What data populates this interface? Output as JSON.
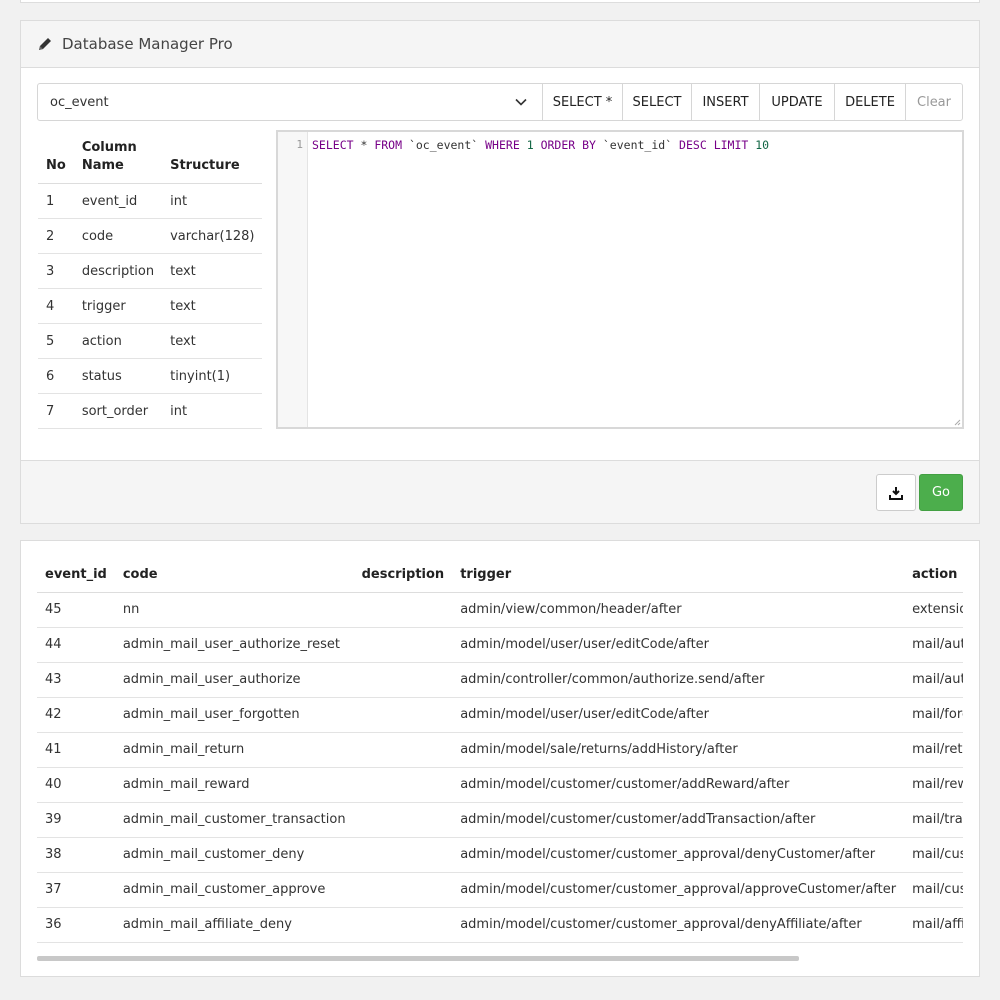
{
  "panel": {
    "title": "Database Manager Pro",
    "icon": "pencil-icon"
  },
  "toolbar": {
    "table_value": "oc_event",
    "buttons": [
      "SELECT *",
      "SELECT",
      "INSERT",
      "UPDATE",
      "DELETE",
      "Clear"
    ]
  },
  "columns_table": {
    "headers": {
      "no": "No",
      "name": "Column Name",
      "structure": "Structure"
    },
    "rows": [
      {
        "no": "1",
        "name": "event_id",
        "structure": "int"
      },
      {
        "no": "2",
        "name": "code",
        "structure": "varchar(128)"
      },
      {
        "no": "3",
        "name": "description",
        "structure": "text"
      },
      {
        "no": "4",
        "name": "trigger",
        "structure": "text"
      },
      {
        "no": "5",
        "name": "action",
        "structure": "text"
      },
      {
        "no": "6",
        "name": "status",
        "structure": "tinyint(1)"
      },
      {
        "no": "7",
        "name": "sort_order",
        "structure": "int"
      }
    ]
  },
  "editor": {
    "line_number": "1",
    "tokens": [
      {
        "t": "SELECT",
        "c": "kw"
      },
      {
        "t": " * ",
        "c": ""
      },
      {
        "t": "FROM",
        "c": "kw"
      },
      {
        "t": " `oc_event` ",
        "c": ""
      },
      {
        "t": "WHERE",
        "c": "kw"
      },
      {
        "t": " ",
        "c": ""
      },
      {
        "t": "1",
        "c": "num"
      },
      {
        "t": " ",
        "c": ""
      },
      {
        "t": "ORDER BY",
        "c": "kw"
      },
      {
        "t": " `event_id` ",
        "c": ""
      },
      {
        "t": "DESC",
        "c": "kw"
      },
      {
        "t": " ",
        "c": ""
      },
      {
        "t": "LIMIT",
        "c": "kw"
      },
      {
        "t": " ",
        "c": ""
      },
      {
        "t": "10",
        "c": "num"
      }
    ]
  },
  "footer": {
    "go_label": "Go",
    "download_icon": "download-icon"
  },
  "results": {
    "headers": [
      "event_id",
      "code",
      "description",
      "trigger",
      "action"
    ],
    "rows": [
      [
        "45",
        "nn",
        "",
        "admin/view/common/header/after",
        "extension/nanet/i"
      ],
      [
        "44",
        "admin_mail_user_authorize_reset",
        "",
        "admin/model/user/user/editCode/after",
        "mail/authorize.res"
      ],
      [
        "43",
        "admin_mail_user_authorize",
        "",
        "admin/controller/common/authorize.send/after",
        "mail/authorize"
      ],
      [
        "42",
        "admin_mail_user_forgotten",
        "",
        "admin/model/user/user/editCode/after",
        "mail/forgotten"
      ],
      [
        "41",
        "admin_mail_return",
        "",
        "admin/model/sale/returns/addHistory/after",
        "mail/returns"
      ],
      [
        "40",
        "admin_mail_reward",
        "",
        "admin/model/customer/customer/addReward/after",
        "mail/reward"
      ],
      [
        "39",
        "admin_mail_customer_transaction",
        "",
        "admin/model/customer/customer/addTransaction/after",
        "mail/transaction"
      ],
      [
        "38",
        "admin_mail_customer_deny",
        "",
        "admin/model/customer/customer_approval/denyCustomer/after",
        "mail/customer.de"
      ],
      [
        "37",
        "admin_mail_customer_approve",
        "",
        "admin/model/customer/customer_approval/approveCustomer/after",
        "mail/customer.ap"
      ],
      [
        "36",
        "admin_mail_affiliate_deny",
        "",
        "admin/model/customer/customer_approval/denyAffiliate/after",
        "mail/affiliate.deny"
      ]
    ]
  }
}
